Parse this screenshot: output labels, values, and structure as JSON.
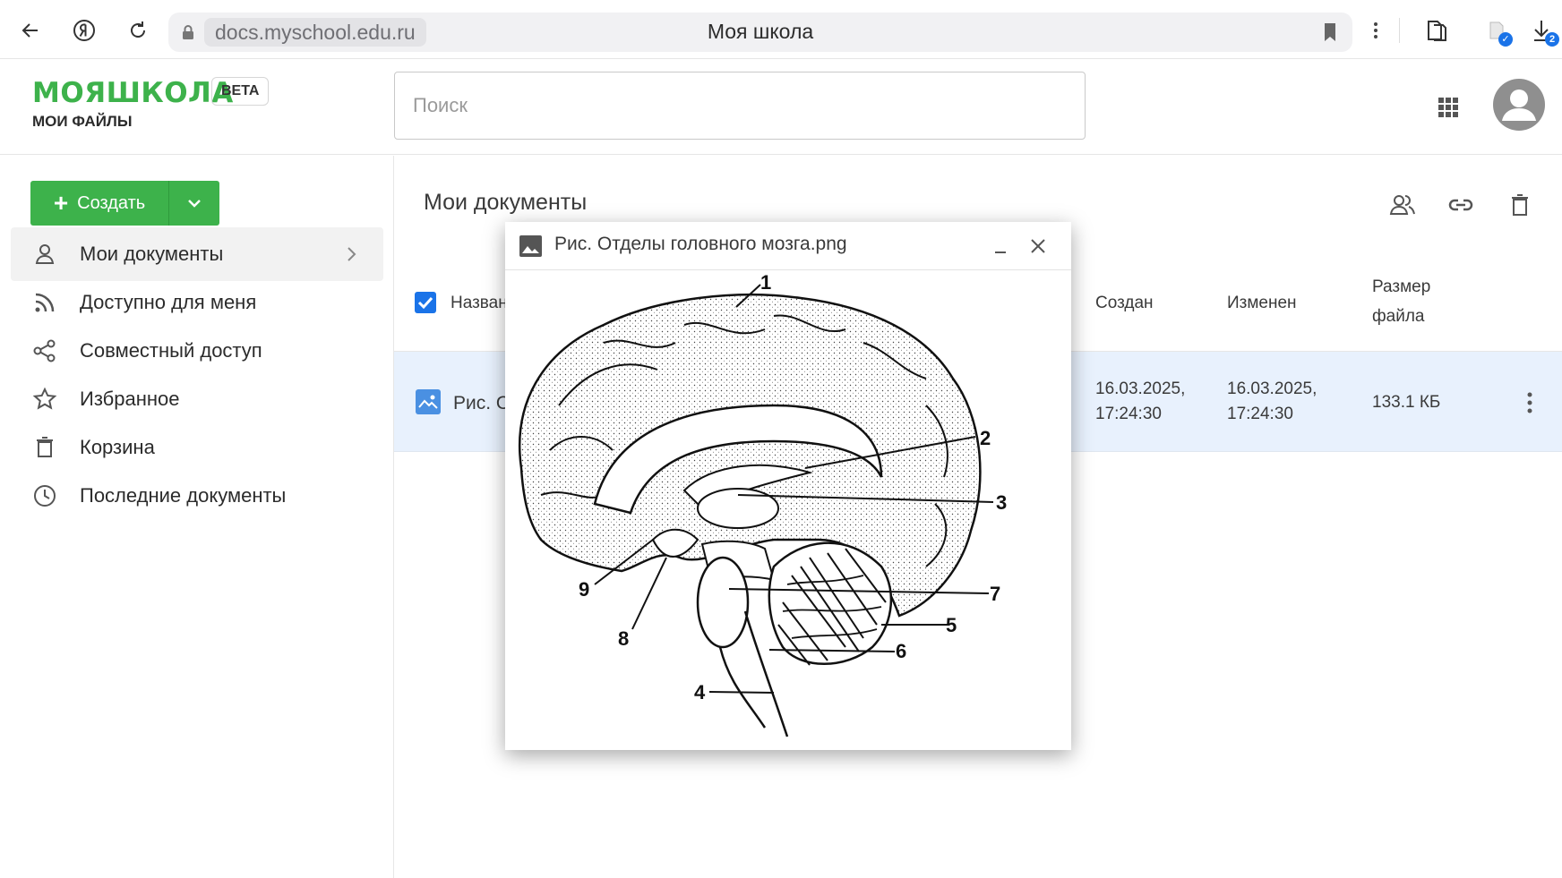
{
  "browser": {
    "url": "docs.myschool.edu.ru",
    "tab_title": "Моя школа",
    "download_badge": "2"
  },
  "app": {
    "brand": "МОЯШКОЛА",
    "beta": "BETA",
    "section": "МОИ ФАЙЛЫ",
    "search_placeholder": "Поиск"
  },
  "sidebar": {
    "create_label": "Создать",
    "items": [
      {
        "label": "Мои документы",
        "icon": "person-icon",
        "active": true
      },
      {
        "label": "Доступно для меня",
        "icon": "rss-icon"
      },
      {
        "label": "Совместный доступ",
        "icon": "share-icon"
      },
      {
        "label": "Избранное",
        "icon": "star-icon"
      },
      {
        "label": "Корзина",
        "icon": "trash-icon"
      },
      {
        "label": "Последние документы",
        "icon": "clock-icon"
      }
    ]
  },
  "main": {
    "title": "Мои документы",
    "columns": {
      "name": "Название",
      "created": "Создан",
      "modified": "Изменен",
      "size_line1": "Размер",
      "size_line2": "файла"
    },
    "rows": [
      {
        "name": "Рис. Отделы головного мозга.png",
        "created_date": "16.03.2025,",
        "created_time": "17:24:30",
        "modified_date": "16.03.2025,",
        "modified_time": "17:24:30",
        "size": "133.1 КБ"
      }
    ]
  },
  "preview": {
    "title": "Рис. Отделы головного мозга.png",
    "image_labels": [
      "1",
      "2",
      "3",
      "4",
      "5",
      "6",
      "7",
      "8",
      "9"
    ]
  },
  "colors": {
    "brand_green": "#3db24b",
    "accent_blue": "#1a73e8",
    "selected_row": "#e8f1fd"
  }
}
